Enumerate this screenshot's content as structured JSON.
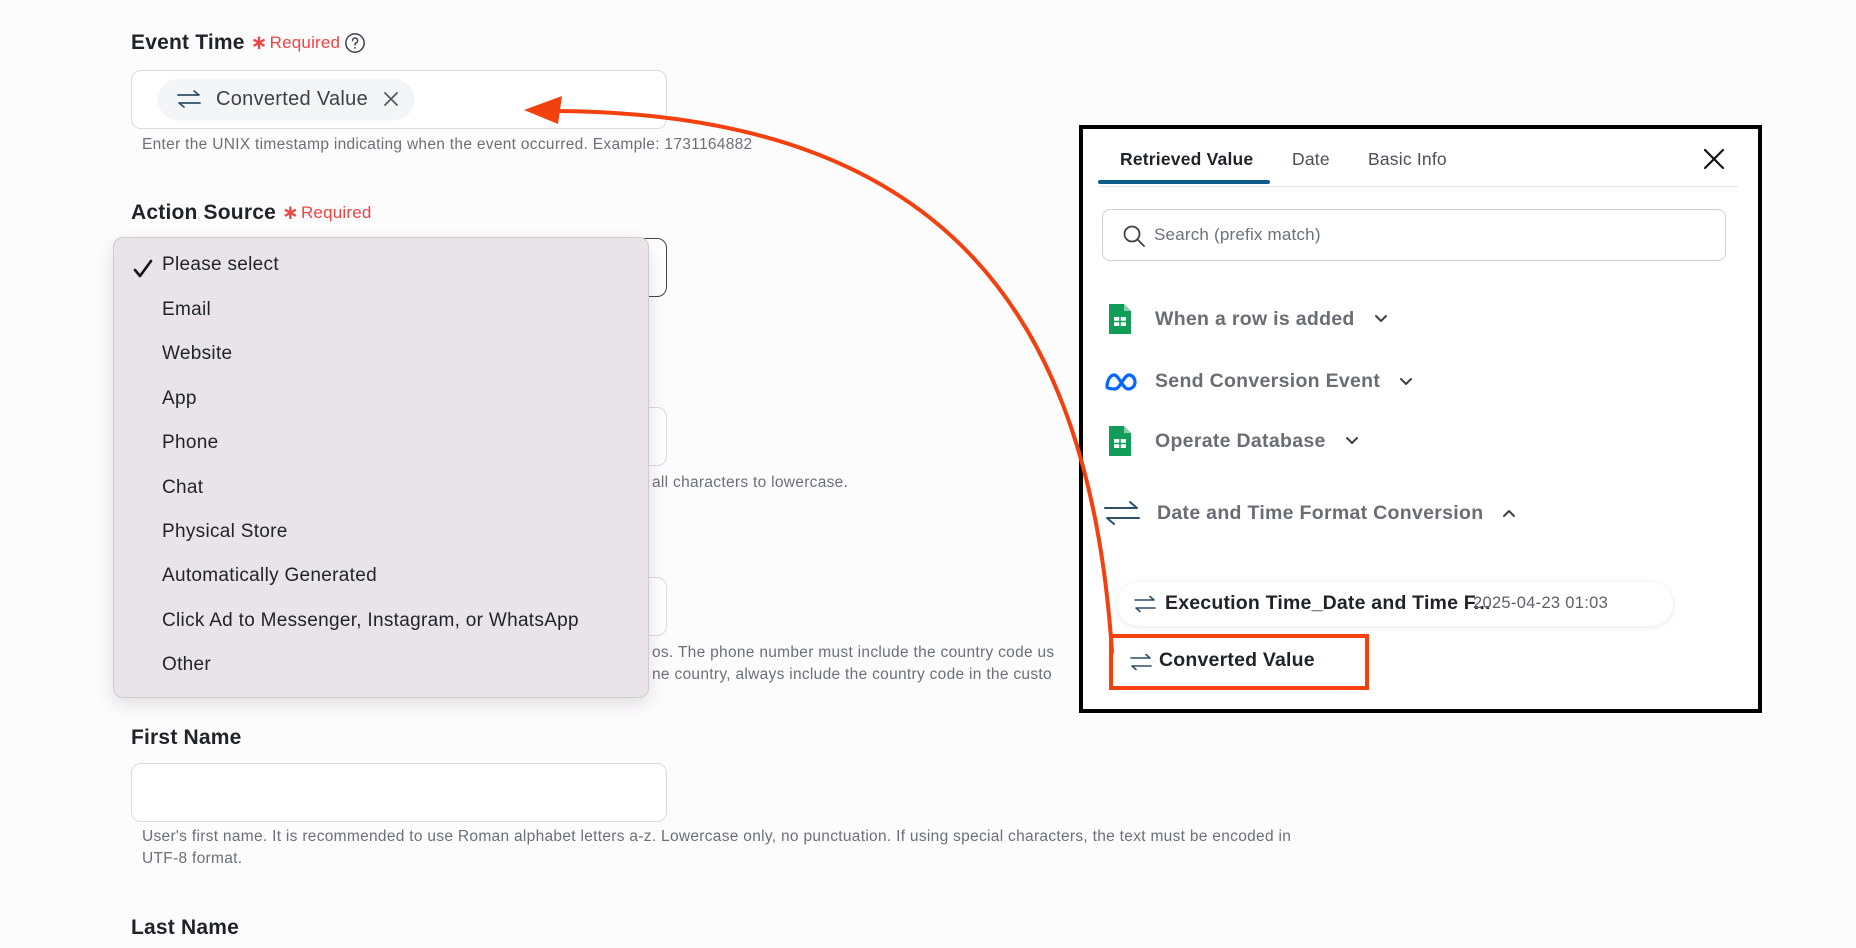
{
  "event_time": {
    "label": "Event Time",
    "required_star": "∗",
    "required": "Required",
    "tag_label": "Converted Value",
    "hint": "Enter the UNIX timestamp indicating when the event occurred. Example: 1731164882"
  },
  "action_source": {
    "label": "Action Source",
    "required_star": "∗",
    "required": "Required",
    "selected": "Please select",
    "options": [
      "Please select",
      "Email",
      "Website",
      "App",
      "Phone",
      "Chat",
      "Physical Store",
      "Automatically Generated",
      "Click Ad to Messenger, Instagram, or WhatsApp",
      "Other"
    ]
  },
  "hidden_fields": {
    "email_hint_fragment": "all characters to lowercase.",
    "phone_hint_line1_fragment": "os. The phone number must include the country code us",
    "phone_hint_line2_fragment": "ne country, always include the country code in the custo"
  },
  "first_name": {
    "label": "First Name",
    "value": "",
    "hint_line1": "User's first name. It is recommended to use Roman alphabet letters a-z. Lowercase only, no punctuation. If using special characters, the text must be encoded in",
    "hint_line2": "UTF-8 format."
  },
  "last_name": {
    "label": "Last Name"
  },
  "panel": {
    "tabs": [
      "Retrieved Value",
      "Date",
      "Basic Info"
    ],
    "active_tab": "Retrieved Value",
    "search_placeholder": "Search (prefix match)",
    "nodes": [
      {
        "name": "When a row is added",
        "icon": "google-sheets-icon",
        "expanded": false
      },
      {
        "name": "Send Conversion Event",
        "icon": "meta-icon",
        "expanded": false
      },
      {
        "name": "Operate Database",
        "icon": "google-sheets-icon",
        "expanded": false
      },
      {
        "name": "Date and Time Format Conversion",
        "icon": "convert-arrows-icon",
        "expanded": true
      }
    ],
    "sub_items": [
      {
        "name": "Execution Time_Date and Time F...",
        "value": "2025-04-23 01:03"
      },
      {
        "name": "Converted Value",
        "value": ""
      }
    ]
  },
  "colors": {
    "accent_tab": "#0e5a8a",
    "required": "#ef4444",
    "annotation": "#f2400f",
    "sheets_green": "#0f9d58",
    "meta_blue": "#0866ff"
  }
}
